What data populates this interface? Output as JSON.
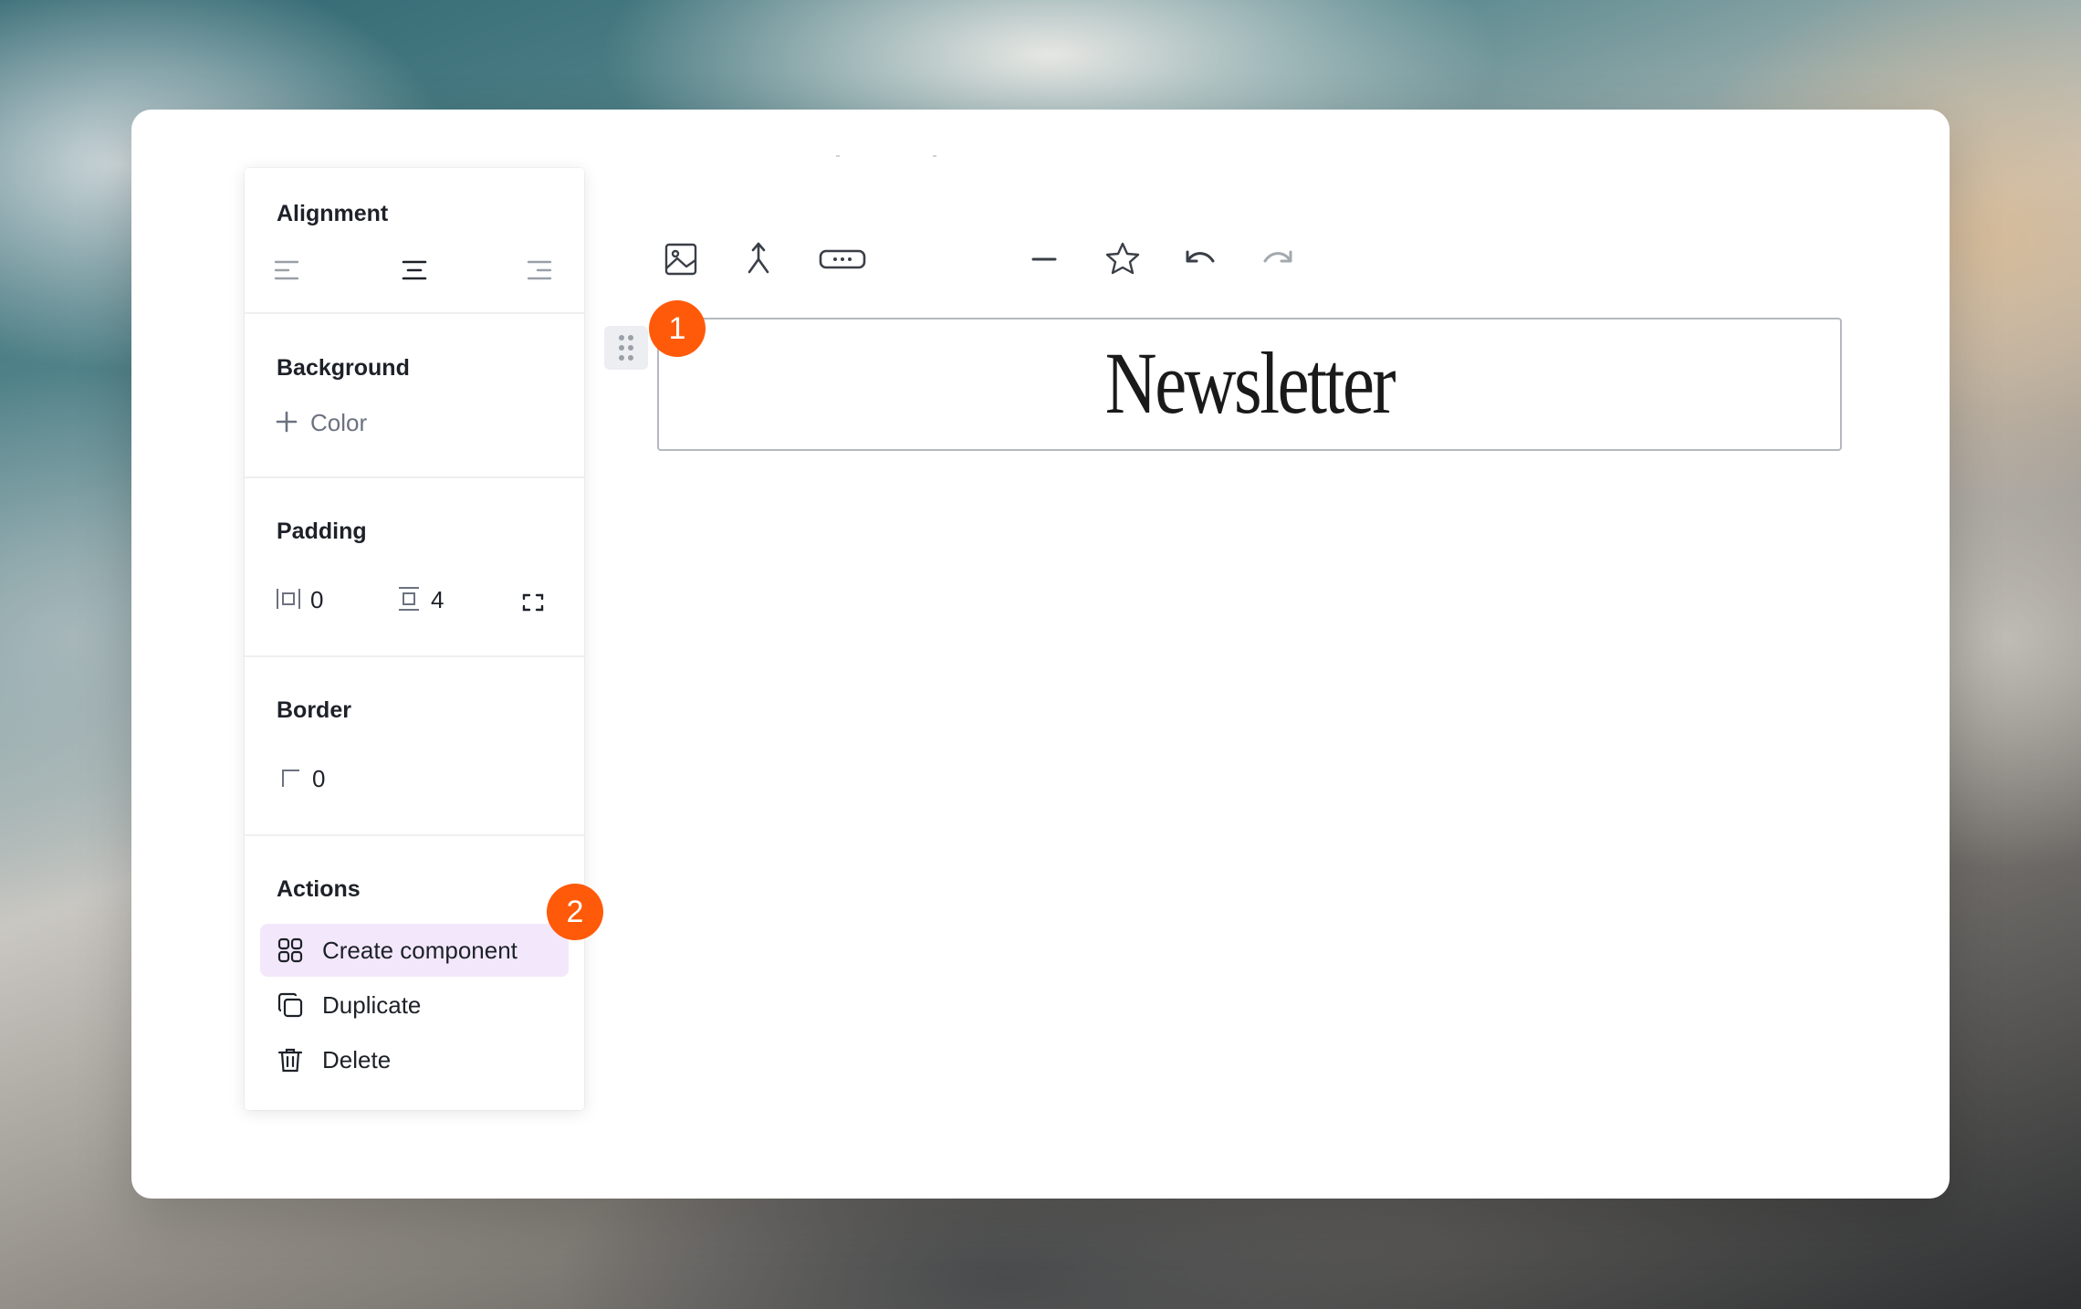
{
  "panel": {
    "alignment": {
      "title": "Alignment",
      "options": [
        "align-left-icon",
        "align-center-icon",
        "align-right-icon"
      ],
      "selected": "align-center"
    },
    "background": {
      "title": "Background",
      "add_label": "Color"
    },
    "padding": {
      "title": "Padding",
      "horizontal": "0",
      "vertical": "4"
    },
    "border": {
      "title": "Border",
      "radius": "0"
    },
    "actions": {
      "title": "Actions",
      "items": [
        {
          "label": "Create component",
          "icon": "component-icon"
        },
        {
          "label": "Duplicate",
          "icon": "duplicate-icon"
        },
        {
          "label": "Delete",
          "icon": "trash-icon"
        }
      ]
    }
  },
  "toolbar": {
    "items": [
      "image-icon",
      "merge-icon",
      "button-icon",
      "divider-icon",
      "star-icon",
      "undo-icon",
      "redo-icon"
    ]
  },
  "editor": {
    "heading": "Newsletter"
  },
  "badges": {
    "first": "1",
    "second": "2"
  },
  "colors": {
    "accent_badge": "#ff5a0a",
    "action_highlight": "#f3e8fb"
  }
}
